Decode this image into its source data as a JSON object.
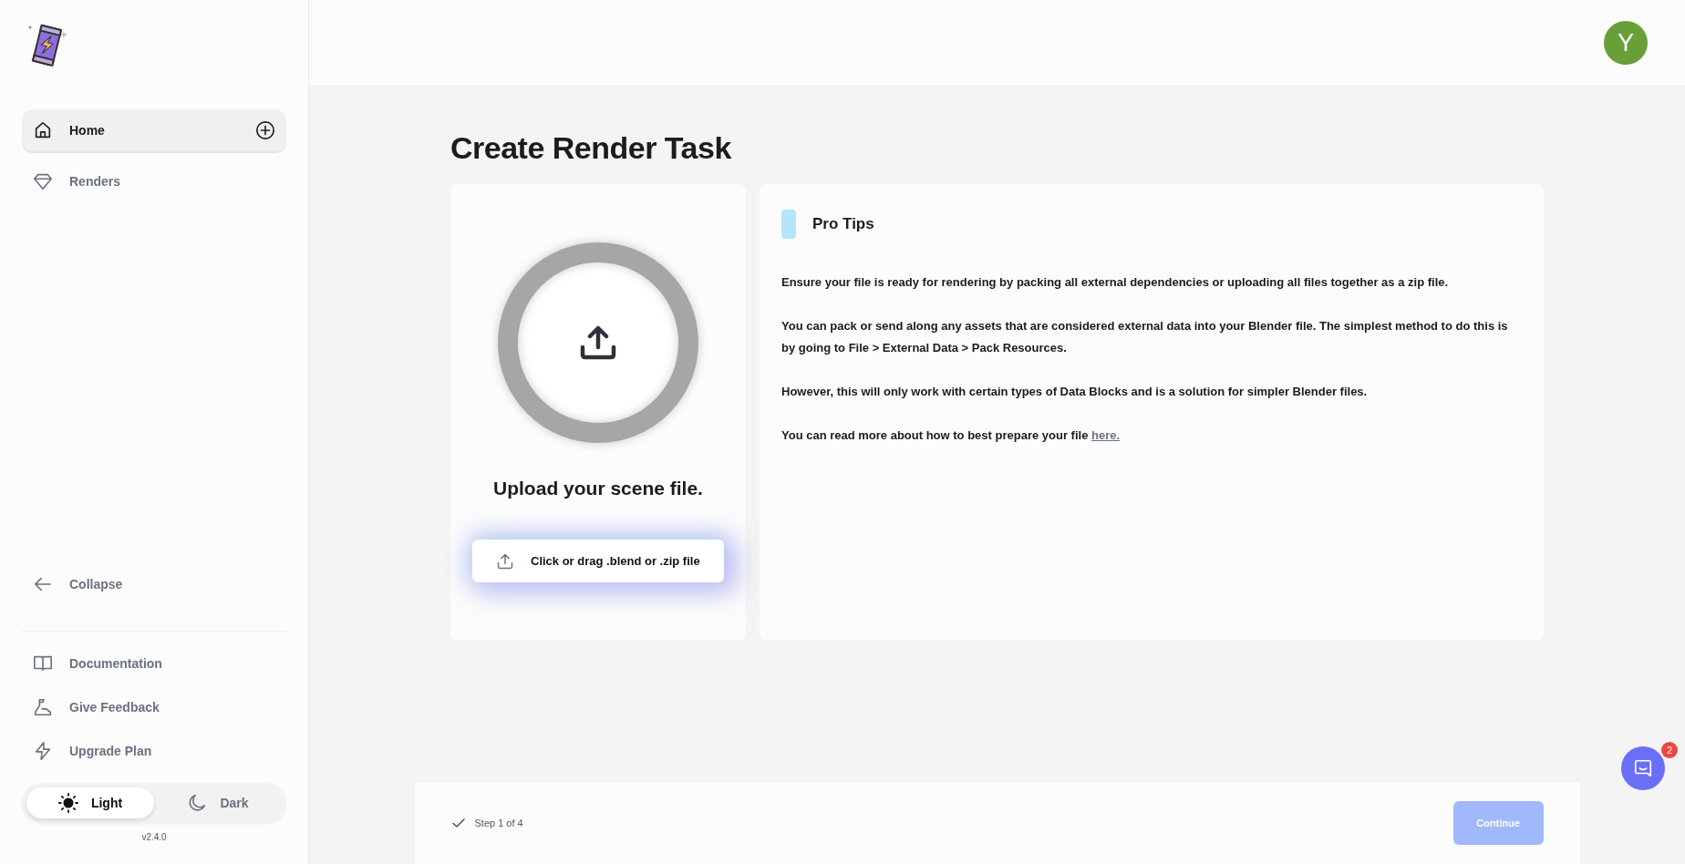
{
  "sidebar": {
    "nav_items": [
      {
        "label": "Home",
        "kind": "home",
        "selected": true,
        "add_button": true
      },
      {
        "label": "Renders",
        "kind": "diamond",
        "selected": false,
        "add_button": false
      }
    ],
    "collapse": {
      "label": "Collapse"
    },
    "footer_links": [
      {
        "label": "Documentation",
        "kind": "book"
      },
      {
        "label": "Give Feedback",
        "kind": "flask"
      },
      {
        "label": "Upgrade Plan",
        "kind": "bolt"
      }
    ],
    "theme_toggle": [
      {
        "label": "Light",
        "kind": "sun",
        "selected": true
      },
      {
        "label": "Dark",
        "kind": "moon",
        "selected": false
      }
    ],
    "version": "v2.4.0"
  },
  "header": {
    "avatar": "Y"
  },
  "page": {
    "title": "Create Render Task",
    "upload": {
      "heading": "Upload your scene file.",
      "button": "Click or drag .blend or .zip file"
    },
    "tips": {
      "title": "Pro Tips",
      "paragraphs": [
        {
          "text": "Ensure your file is ready for rendering by packing all external dependencies or uploading all files together as a zip file."
        },
        {
          "text": "You can pack or send along any assets that are considered external data into your Blender file. The simplest method to do this is by going to File > External Data > Pack Resources."
        },
        {
          "text": "However, this will only work with certain types of Data Blocks and is a solution for simpler Blender files."
        },
        {
          "text": "You can read more about how to best prepare your file",
          "link": "here."
        }
      ]
    }
  },
  "footer": {
    "step": "Step 1 of 4",
    "continue": {
      "label": "Continue",
      "disabled": true
    }
  },
  "chat": {
    "badge": "2"
  }
}
